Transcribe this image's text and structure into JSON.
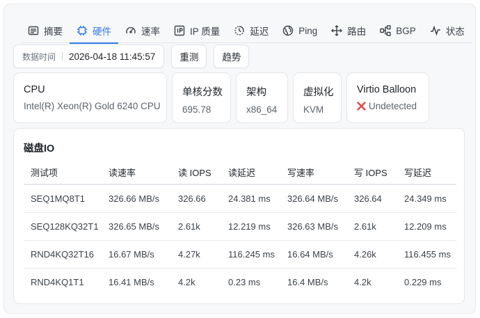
{
  "tabs": [
    {
      "label": "摘要",
      "icon": "summary-icon"
    },
    {
      "label": "硬件",
      "icon": "chip-icon",
      "active": true
    },
    {
      "label": "速率",
      "icon": "speedometer-icon"
    },
    {
      "label": "IP 质量",
      "icon": "ip-icon"
    },
    {
      "label": "延迟",
      "icon": "latency-icon"
    },
    {
      "label": "Ping",
      "icon": "globe-icon"
    },
    {
      "label": "路由",
      "icon": "route-icon"
    },
    {
      "label": "BGP",
      "icon": "network-icon"
    },
    {
      "label": "状态",
      "icon": "pulse-icon"
    }
  ],
  "toolbar": {
    "time_label": "数据时间",
    "time_value": "2026-04-18 11:45:57",
    "retest_label": "重测",
    "trend_label": "趋势"
  },
  "cards": {
    "cpu": {
      "title": "CPU",
      "value": "Intel(R) Xeon(R) Gold 6240 CPU"
    },
    "single_core": {
      "title": "单核分数",
      "value": "695.78"
    },
    "arch": {
      "title": "架构",
      "value": "x86_64"
    },
    "virt": {
      "title": "虚拟化",
      "value": "KVM"
    },
    "balloon": {
      "title": "Virtio Balloon",
      "value": "Undetected",
      "status_color": "#e5484d"
    }
  },
  "disk_io": {
    "title": "磁盘IO",
    "headers": [
      "测试项",
      "读速率",
      "读 IOPS",
      "读延迟",
      "写速率",
      "写 IOPS",
      "写延迟"
    ],
    "rows": [
      [
        "SEQ1MQ8T1",
        "326.66 MB/s",
        "326.66",
        "24.381 ms",
        "326.64 MB/s",
        "326.64",
        "24.349 ms"
      ],
      [
        "SEQ128KQ32T1",
        "326.65 MB/s",
        "2.61k",
        "12.219 ms",
        "326.63 MB/s",
        "2.61k",
        "12.209 ms"
      ],
      [
        "RND4KQ32T16",
        "16.67 MB/s",
        "4.27k",
        "116.245 ms",
        "16.64 MB/s",
        "4.26k",
        "116.455 ms"
      ],
      [
        "RND4KQ1T1",
        "16.41 MB/s",
        "4.2k",
        "0.23 ms",
        "16.4 MB/s",
        "4.2k",
        "0.229 ms"
      ]
    ]
  },
  "colors": {
    "accent": "#2f7ae5",
    "error": "#e5484d"
  }
}
